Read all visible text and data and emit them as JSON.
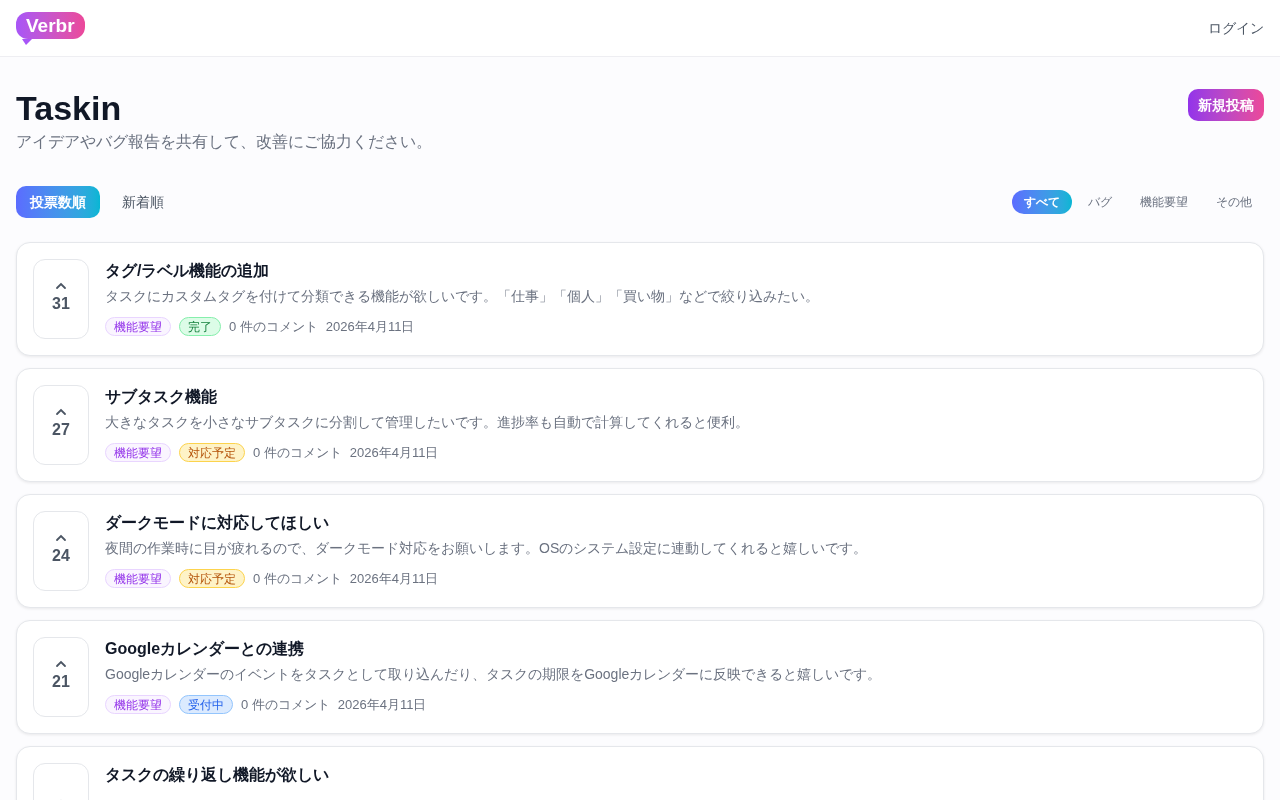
{
  "header": {
    "logo": "Verbr",
    "login": "ログイン"
  },
  "page": {
    "title": "Taskin",
    "subtitle": "アイデアやバグ報告を共有して、改善にご協力ください。",
    "new_post": "新規投稿"
  },
  "sort_tabs": [
    {
      "label": "投票数順",
      "selected": true
    },
    {
      "label": "新着順",
      "selected": false
    }
  ],
  "filters": [
    {
      "label": "すべて",
      "selected": true
    },
    {
      "label": "バグ",
      "selected": false
    },
    {
      "label": "機能要望",
      "selected": false
    },
    {
      "label": "その他",
      "selected": false
    }
  ],
  "posts": [
    {
      "votes": "31",
      "title": "タグ/ラベル機能の追加",
      "description": "タスクにカスタムタグを付けて分類できる機能が欲しいです。「仕事」「個人」「買い物」などで絞り込みたい。",
      "category": {
        "label": "機能要望",
        "kind": "feature"
      },
      "status": {
        "label": "完了",
        "kind": "done"
      },
      "comments": "0 件のコメント",
      "date": "2026年4月11日"
    },
    {
      "votes": "27",
      "title": "サブタスク機能",
      "description": "大きなタスクを小さなサブタスクに分割して管理したいです。進捗率も自動で計算してくれると便利。",
      "category": {
        "label": "機能要望",
        "kind": "feature"
      },
      "status": {
        "label": "対応予定",
        "kind": "planned"
      },
      "comments": "0 件のコメント",
      "date": "2026年4月11日"
    },
    {
      "votes": "24",
      "title": "ダークモードに対応してほしい",
      "description": "夜間の作業時に目が疲れるので、ダークモード対応をお願いします。OSのシステム設定に連動してくれると嬉しいです。",
      "category": {
        "label": "機能要望",
        "kind": "feature"
      },
      "status": {
        "label": "対応予定",
        "kind": "planned"
      },
      "comments": "0 件のコメント",
      "date": "2026年4月11日"
    },
    {
      "votes": "21",
      "title": "Googleカレンダーとの連携",
      "description": "Googleカレンダーのイベントをタスクとして取り込んだり、タスクの期限をGoogleカレンダーに反映できると嬉しいです。",
      "category": {
        "label": "機能要望",
        "kind": "feature"
      },
      "status": {
        "label": "受付中",
        "kind": "open"
      },
      "comments": "0 件のコメント",
      "date": "2026年4月11日"
    },
    {
      "title": "タスクの繰り返し機能が欲しい"
    }
  ]
}
